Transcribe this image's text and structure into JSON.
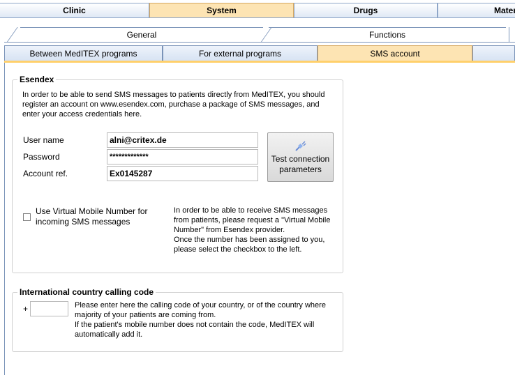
{
  "top_tabs": [
    "Clinic",
    "System",
    "Drugs",
    "Mater"
  ],
  "sub_tabs": [
    "General",
    "Functions"
  ],
  "third_tabs": [
    "Between MedITEX programs",
    "For external programs",
    "SMS account"
  ],
  "esendex": {
    "title": "Esendex",
    "intro": "In order to be able to send SMS messages to patients directly from MedITEX, you should register an account on www.esendex.com, purchase a package of SMS messages, and enter your access credentials here.",
    "username_label": "User name",
    "username_value": "alni@critex.de",
    "password_label": "Password",
    "password_value": "*************",
    "account_label": "Account ref.",
    "account_value": "Ex0145287",
    "test_button": "Test connection parameters",
    "vmn_checkbox_label": "Use Virtual Mobile Number for incoming SMS messages",
    "vmn_info": "In order to be able to receive SMS messages from patients, please request a \"Virtual Mobile Number\" from Esendex provider.\nOnce the number has been assigned to you, please select the checkbox to the left."
  },
  "calling_code": {
    "title": "International country calling code",
    "plus": "+",
    "value": "",
    "info": "Please enter here the calling code of your country, or of the country where majority of your patients are coming from.\nIf the patient's mobile number does not contain the code, MedITEX will automatically add it."
  }
}
